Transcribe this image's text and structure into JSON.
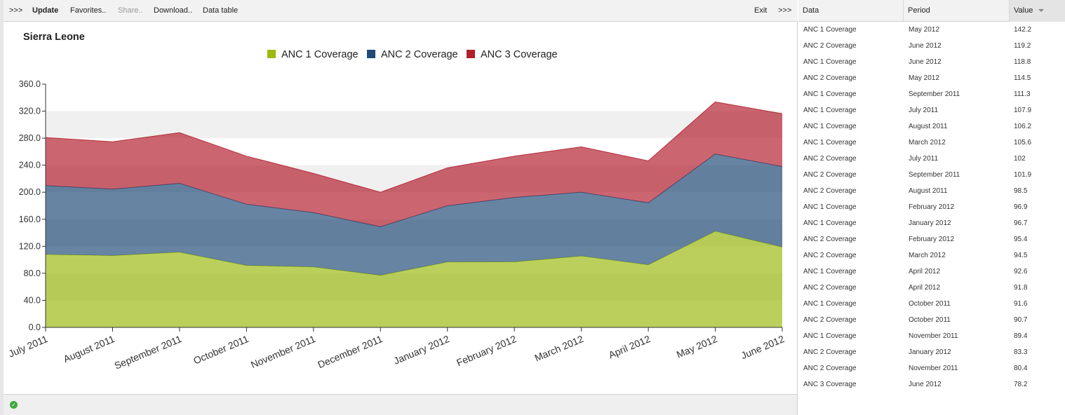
{
  "toolbar": {
    "left_expand": ">>>",
    "update": "Update",
    "favorites": "Favorites..",
    "share": "Share..",
    "download": "Download..",
    "data_table": "Data table",
    "exit": "Exit",
    "right_expand": ">>>"
  },
  "colors": {
    "anc1": "#9bba0f",
    "anc2": "#1f4a77",
    "anc3": "#b31e2d"
  },
  "chart_data": {
    "type": "area",
    "stacked": true,
    "title": "Sierra Leone",
    "legend_position": "top-center",
    "categories": [
      "July 2011",
      "August 2011",
      "September 2011",
      "October 2011",
      "November 2011",
      "December 2011",
      "January 2012",
      "February 2012",
      "March 2012",
      "April 2012",
      "May 2012",
      "June 2012"
    ],
    "y_ticks": [
      "0.0",
      "40.0",
      "80.0",
      "120.0",
      "160.0",
      "200.0",
      "240.0",
      "280.0",
      "320.0",
      "360.0"
    ],
    "ylim": [
      0,
      360
    ],
    "series": [
      {
        "name": "ANC 1 Coverage",
        "values": [
          107.9,
          106.2,
          111.3,
          91.6,
          89.4,
          77.0,
          96.7,
          96.9,
          105.6,
          92.6,
          142.2,
          118.8
        ]
      },
      {
        "name": "ANC 2 Coverage",
        "values": [
          102,
          98.5,
          101.9,
          90.7,
          80.4,
          72.0,
          83.3,
          95.4,
          94.5,
          91.8,
          114.5,
          119.2
        ]
      },
      {
        "name": "ANC 3 Coverage",
        "values": [
          71,
          70,
          75,
          71,
          58,
          51,
          56,
          61,
          67,
          62,
          77,
          78.2
        ]
      }
    ]
  },
  "table": {
    "headers": [
      "Data",
      "Period",
      "Value"
    ],
    "rows": [
      [
        "ANC 1 Coverage",
        "May 2012",
        "142.2"
      ],
      [
        "ANC 2 Coverage",
        "June 2012",
        "119.2"
      ],
      [
        "ANC 1 Coverage",
        "June 2012",
        "118.8"
      ],
      [
        "ANC 2 Coverage",
        "May 2012",
        "114.5"
      ],
      [
        "ANC 1 Coverage",
        "September 2011",
        "111.3"
      ],
      [
        "ANC 1 Coverage",
        "July 2011",
        "107.9"
      ],
      [
        "ANC 1 Coverage",
        "August 2011",
        "106.2"
      ],
      [
        "ANC 1 Coverage",
        "March 2012",
        "105.6"
      ],
      [
        "ANC 2 Coverage",
        "July 2011",
        "102"
      ],
      [
        "ANC 2 Coverage",
        "September 2011",
        "101.9"
      ],
      [
        "ANC 2 Coverage",
        "August 2011",
        "98.5"
      ],
      [
        "ANC 1 Coverage",
        "February 2012",
        "96.9"
      ],
      [
        "ANC 1 Coverage",
        "January 2012",
        "96.7"
      ],
      [
        "ANC 2 Coverage",
        "February 2012",
        "95.4"
      ],
      [
        "ANC 2 Coverage",
        "March 2012",
        "94.5"
      ],
      [
        "ANC 1 Coverage",
        "April 2012",
        "92.6"
      ],
      [
        "ANC 2 Coverage",
        "April 2012",
        "91.8"
      ],
      [
        "ANC 1 Coverage",
        "October 2011",
        "91.6"
      ],
      [
        "ANC 2 Coverage",
        "October 2011",
        "90.7"
      ],
      [
        "ANC 1 Coverage",
        "November 2011",
        "89.4"
      ],
      [
        "ANC 2 Coverage",
        "January 2012",
        "83.3"
      ],
      [
        "ANC 2 Coverage",
        "November 2011",
        "80.4"
      ],
      [
        "ANC 3 Coverage",
        "June 2012",
        "78.2"
      ]
    ]
  }
}
